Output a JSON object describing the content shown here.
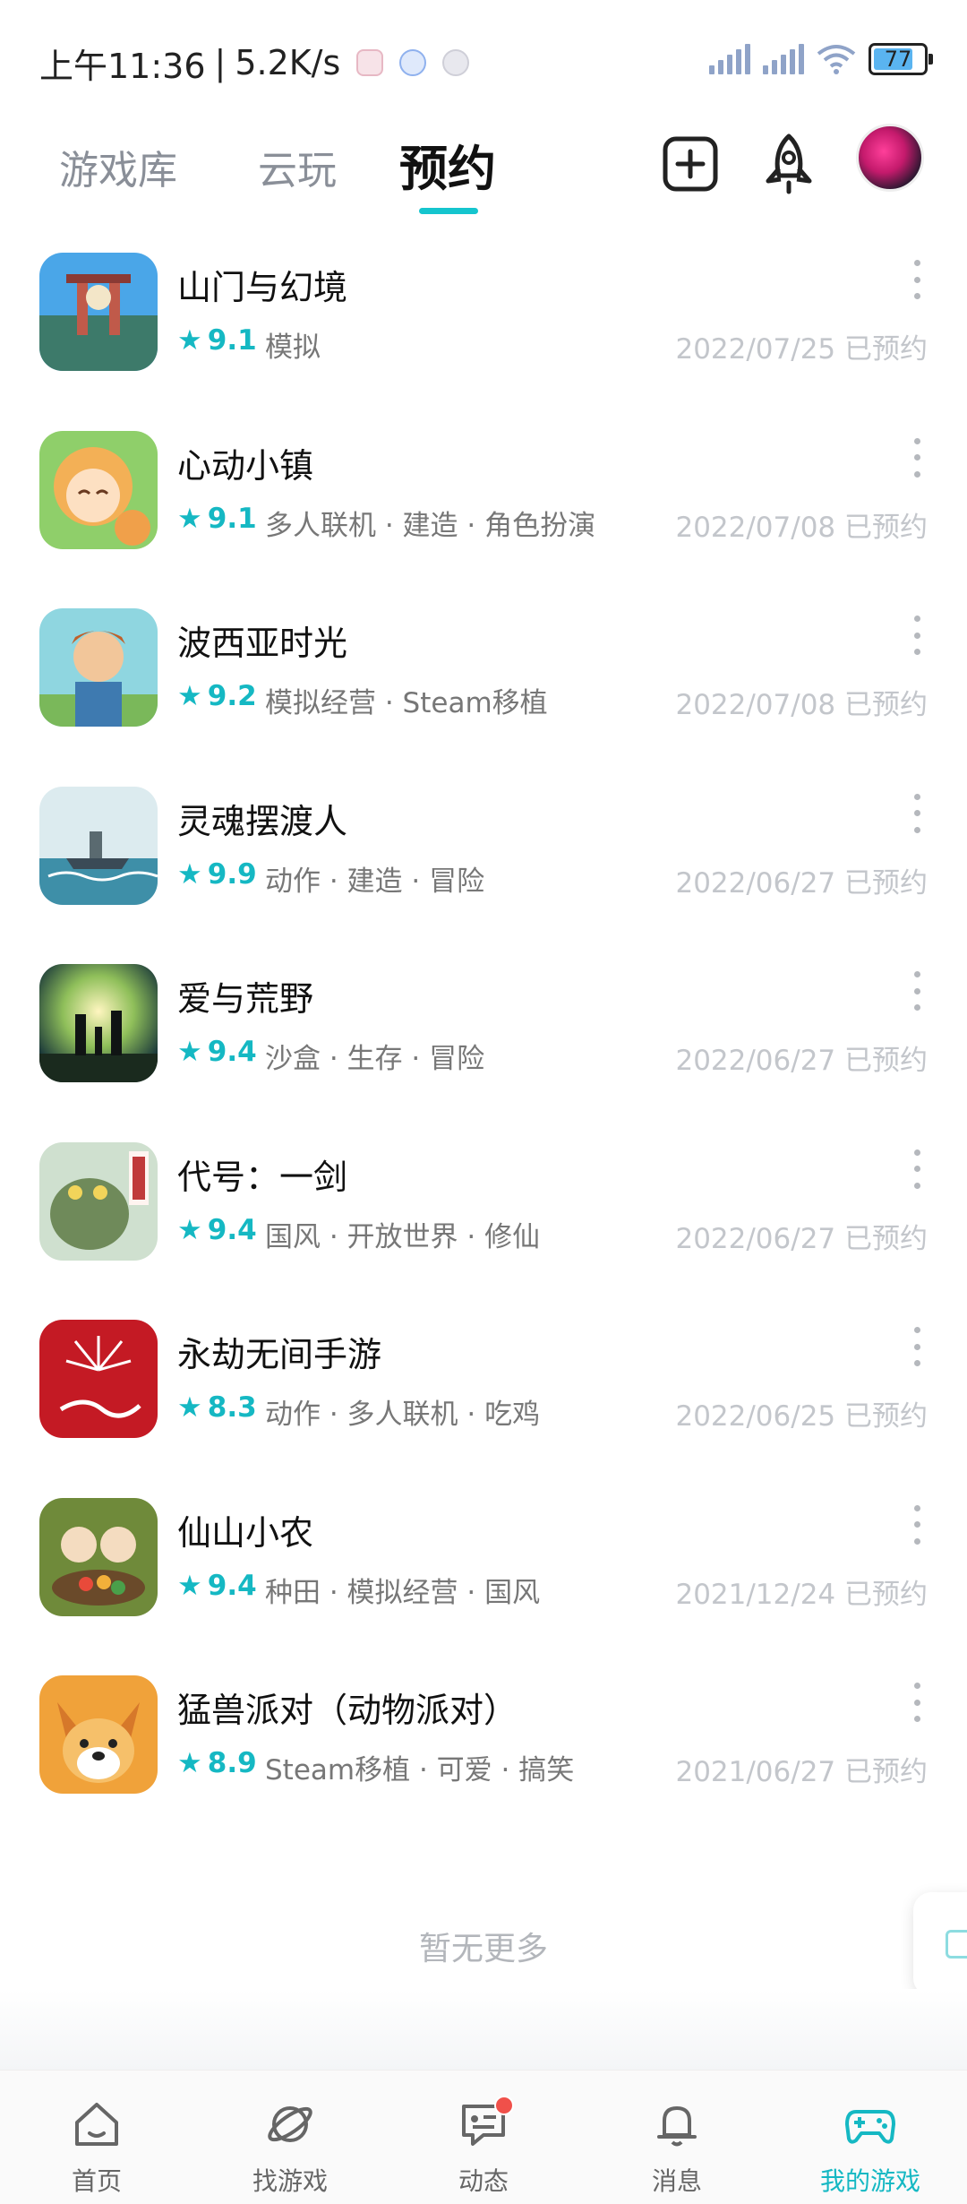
{
  "status_bar": {
    "time": "上午11:36",
    "separator": "|",
    "net_speed": "5.2K/s",
    "battery": "77"
  },
  "top_nav": {
    "tabs": [
      {
        "label": "游戏库",
        "active": false
      },
      {
        "label": "云玩",
        "active": false
      },
      {
        "label": "预约",
        "active": true
      }
    ],
    "accent_color": "#15c5ce"
  },
  "games": [
    {
      "title": "山门与幻境",
      "rating": "9.1",
      "tags": "模拟",
      "date": "2022/07/25 已预约",
      "icon": "game-icon-shanmen"
    },
    {
      "title": "心动小镇",
      "rating": "9.1",
      "tags": "多人联机 · 建造 · 角色扮演",
      "date": "2022/07/08 已预约",
      "icon": "game-icon-xindong"
    },
    {
      "title": "波西亚时光",
      "rating": "9.2",
      "tags": "模拟经营 · Steam移植",
      "date": "2022/07/08 已预约",
      "icon": "game-icon-portia"
    },
    {
      "title": "灵魂摆渡人",
      "rating": "9.9",
      "tags": "动作 · 建造 · 冒险",
      "date": "2022/06/27 已预约",
      "icon": "game-icon-spiritfarer"
    },
    {
      "title": "爱与荒野",
      "rating": "9.4",
      "tags": "沙盒 · 生存 · 冒险",
      "date": "2022/06/27 已预约",
      "icon": "game-icon-wild"
    },
    {
      "title": "代号：一剑",
      "rating": "9.4",
      "tags": "国风 · 开放世界 · 修仙",
      "date": "2022/06/27 已预约",
      "icon": "game-icon-yijian"
    },
    {
      "title": "永劫无间手游",
      "rating": "8.3",
      "tags": "动作 · 多人联机 · 吃鸡",
      "date": "2022/06/25 已预约",
      "icon": "game-icon-naraka"
    },
    {
      "title": "仙山小农",
      "rating": "9.4",
      "tags": "种田 · 模拟经营 · 国风",
      "date": "2021/12/24 已预约",
      "icon": "game-icon-xianshan"
    },
    {
      "title": "猛兽派对（动物派对）",
      "rating": "8.9",
      "tags": "Steam移植 · 可爱 · 搞笑",
      "date": "2021/06/27 已预约",
      "icon": "game-icon-party"
    }
  ],
  "footer_text": "暂无更多",
  "bottom_nav": [
    {
      "label": "首页",
      "icon": "home-icon",
      "active": false
    },
    {
      "label": "找游戏",
      "icon": "planet-icon",
      "active": false
    },
    {
      "label": "动态",
      "icon": "chat-icon",
      "active": false,
      "badge": true
    },
    {
      "label": "消息",
      "icon": "bell-icon",
      "active": false
    },
    {
      "label": "我的游戏",
      "icon": "gamepad-icon",
      "active": true
    }
  ]
}
